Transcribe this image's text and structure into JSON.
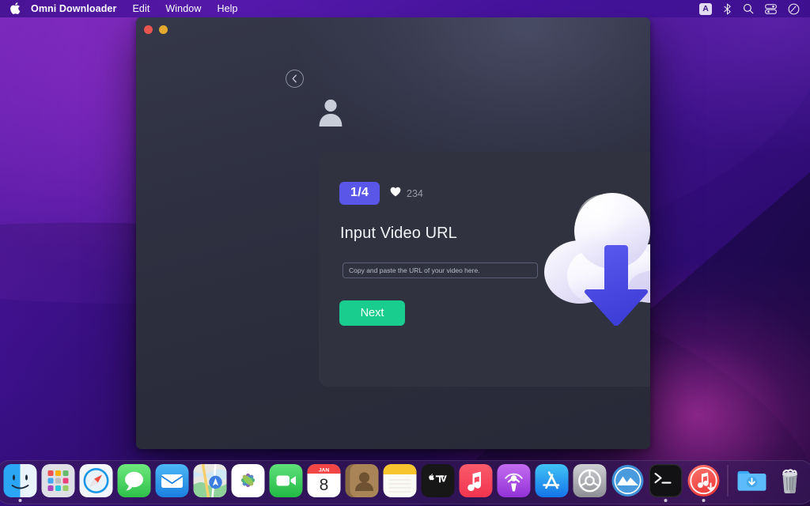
{
  "menubar": {
    "apple_logo": "",
    "app_name": "Omni Downloader",
    "menus": [
      "Edit",
      "Window",
      "Help"
    ],
    "status_items": [
      {
        "name": "input-source-badge",
        "label": "A"
      },
      {
        "name": "bluetooth-icon",
        "label": ""
      },
      {
        "name": "spotlight-search-icon",
        "label": ""
      },
      {
        "name": "control-center-icon",
        "label": ""
      },
      {
        "name": "siri-icon",
        "label": ""
      }
    ]
  },
  "window": {
    "traffic_lights": [
      "close",
      "minimize"
    ],
    "back_button_label": "Back",
    "avatar_label": "User avatar"
  },
  "card": {
    "step_badge": "1/4",
    "likes_count": "234",
    "title": "Input Video URL",
    "input_placeholder": "Copy and paste the URL of your video here.",
    "input_value": "",
    "next_label": "Next",
    "illustration": "cloud-download-illustration",
    "color_dots": [
      {
        "name": "dot-teal",
        "color": "#3fd1c1",
        "selected": true
      },
      {
        "name": "dot-purple",
        "color": "#8b85e8",
        "selected": false
      },
      {
        "name": "dot-pink",
        "color": "#e8679c",
        "selected": false
      },
      {
        "name": "dot-lime",
        "color": "#d2e05a",
        "selected": false
      }
    ]
  },
  "theme": {
    "accent_indigo": "#5956e8",
    "accent_green": "#19cd8e",
    "card_bg": "#30323f",
    "window_bg": "#2f3142"
  },
  "dock": {
    "items": [
      {
        "name": "finder",
        "label": "Finder",
        "running": true
      },
      {
        "name": "launchpad",
        "label": "Launchpad",
        "running": false
      },
      {
        "name": "safari",
        "label": "Safari",
        "running": false
      },
      {
        "name": "messages",
        "label": "Messages",
        "running": false
      },
      {
        "name": "mail",
        "label": "Mail",
        "running": false
      },
      {
        "name": "maps",
        "label": "Maps",
        "running": false
      },
      {
        "name": "photos",
        "label": "Photos",
        "running": false
      },
      {
        "name": "facetime",
        "label": "FaceTime",
        "running": false
      },
      {
        "name": "calendar",
        "label": "Calendar",
        "running": false,
        "month": "JAN",
        "day": "8"
      },
      {
        "name": "contacts",
        "label": "Contacts",
        "running": false
      },
      {
        "name": "notes",
        "label": "Notes",
        "running": false
      },
      {
        "name": "appletv",
        "label": "Apple TV",
        "running": false
      },
      {
        "name": "music",
        "label": "Music",
        "running": false
      },
      {
        "name": "podcasts",
        "label": "Podcasts",
        "running": false
      },
      {
        "name": "appstore",
        "label": "App Store",
        "running": false
      },
      {
        "name": "system-preferences",
        "label": "System Preferences",
        "running": false
      },
      {
        "name": "cleanmymac",
        "label": "CleanMyMac",
        "running": false
      },
      {
        "name": "terminal",
        "label": "Terminal",
        "running": true
      },
      {
        "name": "music-downloader",
        "label": "Music Downloader",
        "running": true
      }
    ],
    "trailing": [
      {
        "name": "downloads-folder",
        "label": "Downloads"
      },
      {
        "name": "trash",
        "label": "Trash"
      }
    ]
  }
}
